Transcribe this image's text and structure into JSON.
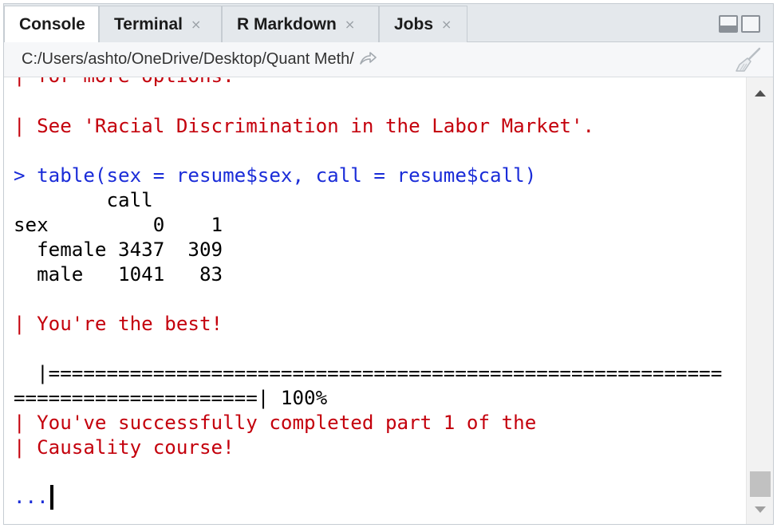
{
  "tabs": [
    {
      "label": "Console",
      "closable": false,
      "active": true
    },
    {
      "label": "Terminal",
      "closable": true,
      "active": false
    },
    {
      "label": "R Markdown",
      "closable": true,
      "active": false
    },
    {
      "label": "Jobs",
      "closable": true,
      "active": false
    }
  ],
  "close_glyph": "×",
  "path": {
    "text": "C:/Users/ashto/OneDrive/Desktop/Quant Meth/",
    "goto_icon": "arrow-goto-icon",
    "clear_icon": "broom-icon"
  },
  "console": {
    "lines": [
      {
        "type": "msg",
        "text": "| for more options."
      },
      {
        "type": "msg",
        "text": "| See 'Racial Discrimination in the Labor Market'."
      },
      {
        "type": "cmd",
        "text": "> table(sex = resume$sex, call = resume$call)"
      },
      {
        "type": "out",
        "text": "        call"
      },
      {
        "type": "out",
        "text": "sex         0    1"
      },
      {
        "type": "out",
        "text": "  female 3437  309"
      },
      {
        "type": "out",
        "text": "  male   1041   83"
      },
      {
        "type": "msg",
        "text": "| You're the best!"
      },
      {
        "type": "out",
        "text": "  |=========================================================="
      },
      {
        "type": "out",
        "text": "=====================| 100%"
      },
      {
        "type": "msg",
        "text": "| You've successfully completed part 1 of the"
      },
      {
        "type": "msg",
        "text": "| Causality course!"
      },
      {
        "type": "cmd",
        "text": "..."
      }
    ]
  },
  "colors": {
    "message": "#c4000c",
    "command": "#1a2cd8",
    "output": "#000000"
  }
}
